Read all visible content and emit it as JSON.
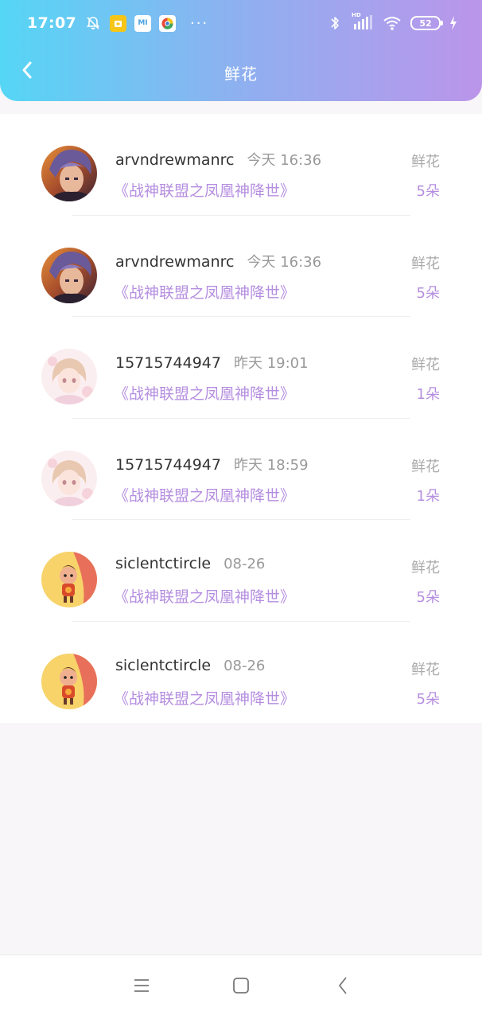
{
  "status_bar": {
    "time": "17:07",
    "notif_icons": [
      "mute-icon",
      "app-yellow-icon",
      "app-mi-icon",
      "app-browser-icon"
    ],
    "notif_mi_text": "MI",
    "more": "···",
    "hd_label": "HD",
    "battery": "52"
  },
  "header": {
    "title": "鲜花",
    "back_icon": "chevron-left-icon"
  },
  "colors": {
    "gradient_start": "#55d6f5",
    "gradient_end": "#bb95ea",
    "accent_purple": "#b58ee0"
  },
  "gifts": [
    {
      "user": "arvndrewmanrc",
      "time": "今天 16:36",
      "type": "鲜花",
      "book": "《战神联盟之凤凰神降世》",
      "count": "5朵",
      "avatar": "anime-boy-avatar"
    },
    {
      "user": "arvndrewmanrc",
      "time": "今天 16:36",
      "type": "鲜花",
      "book": "《战神联盟之凤凰神降世》",
      "count": "5朵",
      "avatar": "anime-boy-avatar"
    },
    {
      "user": "15715744947",
      "time": "昨天 19:01",
      "type": "鲜花",
      "book": "《战神联盟之凤凰神降世》",
      "count": "1朵",
      "avatar": "anime-girl-avatar"
    },
    {
      "user": "15715744947",
      "time": "昨天 18:59",
      "type": "鲜花",
      "book": "《战神联盟之凤凰神降世》",
      "count": "1朵",
      "avatar": "anime-girl-avatar"
    },
    {
      "user": "siclentctircle",
      "time": "08-26",
      "type": "鲜花",
      "book": "《战神联盟之凤凰神降世》",
      "count": "5朵",
      "avatar": "cartoon-character-avatar"
    },
    {
      "user": "siclentctircle",
      "time": "08-26",
      "type": "鲜花",
      "book": "《战神联盟之凤凰神降世》",
      "count": "5朵",
      "avatar": "cartoon-character-avatar"
    }
  ],
  "bottom_nav": [
    "menu-icon",
    "home-icon",
    "back-icon"
  ]
}
